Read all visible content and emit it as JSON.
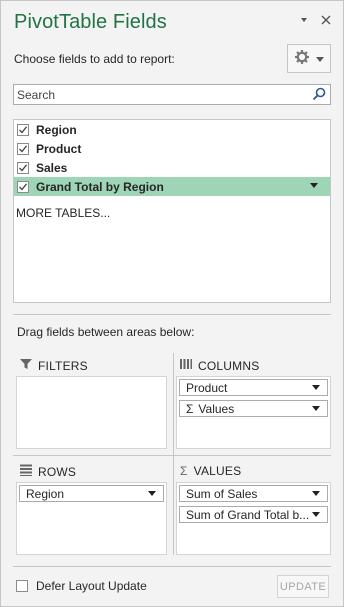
{
  "pane": {
    "title": "PivotTable Fields",
    "choose_label": "Choose fields to add to report:",
    "accent_color": "#217346",
    "selected_row_color": "#9fd5b7"
  },
  "search": {
    "placeholder": "Search",
    "value": ""
  },
  "fields": [
    {
      "label": "Region",
      "checked": true
    },
    {
      "label": "Product",
      "checked": true
    },
    {
      "label": "Sales",
      "checked": true
    },
    {
      "label": "Grand Total by Region",
      "checked": true,
      "selected": true
    }
  ],
  "more_tables_label": "MORE TABLES...",
  "drag_label": "Drag fields between areas below:",
  "areas": {
    "filters": {
      "label": "FILTERS",
      "icon": "filter-icon",
      "items": []
    },
    "columns": {
      "label": "COLUMNS",
      "icon": "columns-icon",
      "items": [
        "Product",
        "Values"
      ]
    },
    "rows": {
      "label": "ROWS",
      "icon": "rows-icon",
      "items": [
        "Region"
      ]
    },
    "values": {
      "label": "VALUES",
      "icon": "sigma-icon",
      "items": [
        "Sum of Sales",
        "Sum of Grand Total b..."
      ]
    }
  },
  "sigma_glyph": "Σ",
  "defer_label": "Defer Layout Update",
  "update_label": "UPDATE"
}
